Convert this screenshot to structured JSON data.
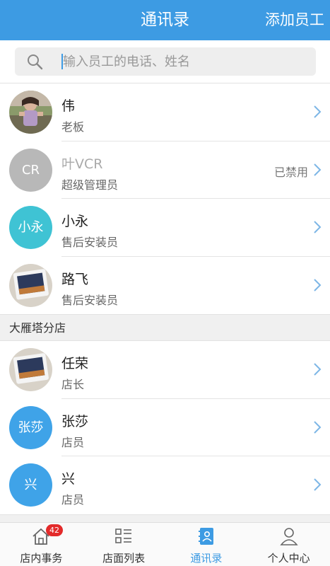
{
  "header": {
    "title": "通讯录",
    "add_label": "添加员工"
  },
  "search": {
    "placeholder": "输入员工的电话、姓名"
  },
  "contacts": [
    {
      "name": "伟",
      "role": "老板",
      "avatar_type": "photo-child",
      "status": ""
    },
    {
      "name": "叶VCR",
      "role": "超级管理员",
      "avatar_text": "CR",
      "avatar_color": "#b8b8b8",
      "status": "已禁用"
    },
    {
      "name": "小永",
      "role": "售后安装员",
      "avatar_text": "小永",
      "avatar_color": "#3fc3d4",
      "status": ""
    },
    {
      "name": "路飞",
      "role": "售后安装员",
      "avatar_type": "photo-phone",
      "status": ""
    }
  ],
  "branch": {
    "title": "大雁塔分店",
    "contacts": [
      {
        "name": "任荣",
        "role": "店长",
        "avatar_type": "photo-phone",
        "status": ""
      },
      {
        "name": "张莎",
        "role": "店员",
        "avatar_text": "张莎",
        "avatar_color": "#3fa3e8",
        "status": ""
      },
      {
        "name": "兴",
        "role": "店员",
        "avatar_text": "兴",
        "avatar_color": "#3fa3e8",
        "status": ""
      }
    ]
  },
  "tabs": [
    {
      "label": "店内事务",
      "icon": "home-icon",
      "badge": "42"
    },
    {
      "label": "店面列表",
      "icon": "list-icon"
    },
    {
      "label": "通讯录",
      "icon": "contacts-icon",
      "active": true
    },
    {
      "label": "个人中心",
      "icon": "profile-icon"
    }
  ],
  "colors": {
    "accent": "#3d9be3",
    "badge": "#e32a2a"
  }
}
